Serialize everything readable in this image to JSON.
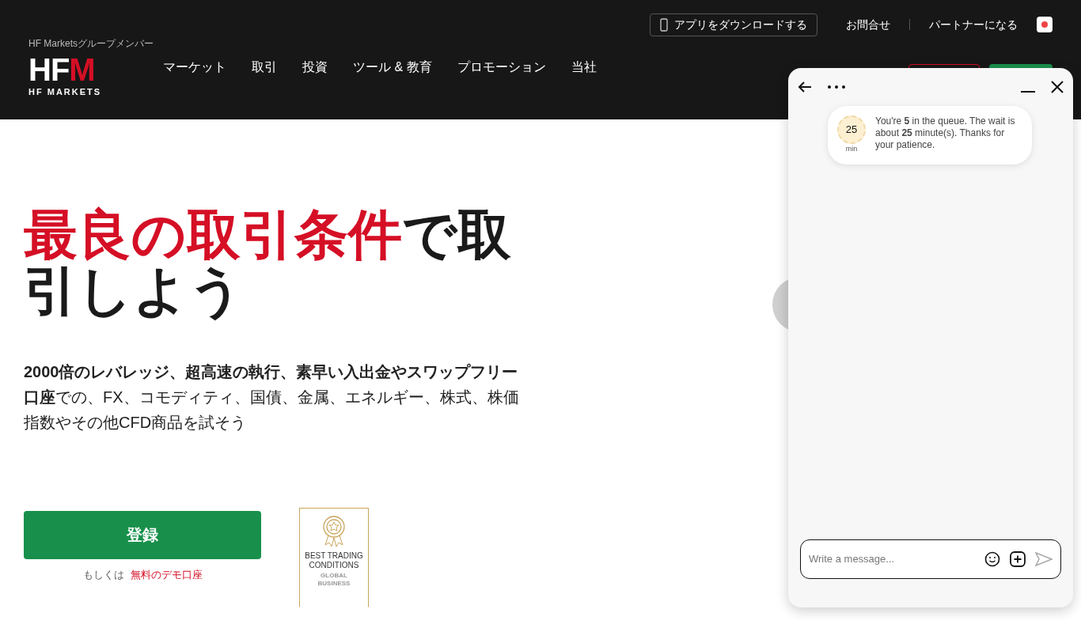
{
  "top_bar": {
    "app_button": "アプリをダウンロードする",
    "links": [
      "お問合せ",
      "パートナーになる"
    ]
  },
  "logo": {
    "tagline": "HF Marketsグループメンバー",
    "mark_left": "HF",
    "mark_right": "M",
    "name": "HF MARKETS"
  },
  "nav": [
    "マーケット",
    "取引",
    "投資",
    "ツール & 教育",
    "プロモーション",
    "当社"
  ],
  "hero": {
    "headline_accent": "最良の取引条件",
    "headline_rest": "で取引しよう",
    "description": "**2000倍のレバレッジ、超高速の執行、素早い入出金やスワップフリー口座**での、FX、コモディティ、国債、金属、エネルギー、株式、株価指数やその他CFD商品を試そう",
    "register_button": "登録",
    "or_text": "もしくは",
    "demo_link": "無料のデモ口座"
  },
  "award": {
    "line1": "BEST TRADING",
    "line2": "CONDITIONS",
    "line3": "GLOBAL",
    "line4": "BUSINESS"
  },
  "chat": {
    "timer": "25",
    "timer_unit": "min",
    "message": "You're **5** in the queue. The wait is about **25** minute(s). Thanks for your patience.",
    "input": {
      "placeholder": "Write a message..."
    }
  }
}
